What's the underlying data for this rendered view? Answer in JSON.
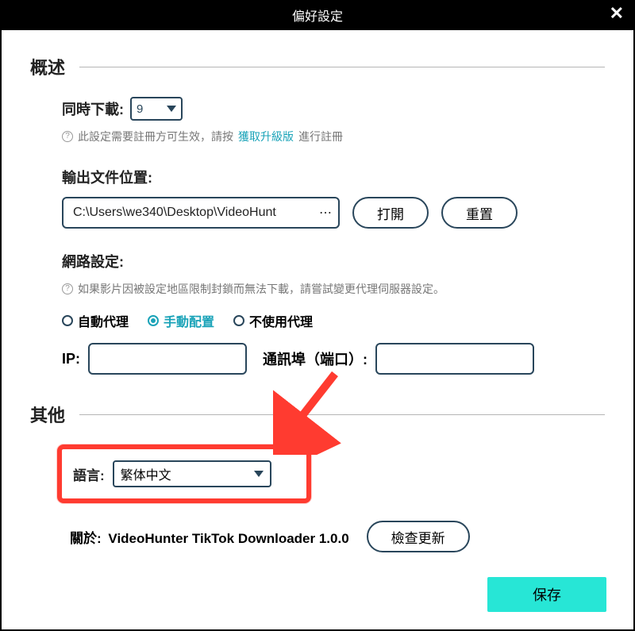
{
  "window": {
    "title": "偏好設定"
  },
  "overview": {
    "heading": "概述",
    "concurrent_label": "同時下載:",
    "concurrent_value": "9",
    "concurrent_hint_prefix": "此設定需要註冊方可生效，請按",
    "concurrent_hint_link": "獲取升級版",
    "concurrent_hint_suffix": "進行註冊",
    "output_label": "輸出文件位置:",
    "output_path": "C:\\Users\\we340\\Desktop\\VideoHunt",
    "open_btn": "打開",
    "reset_btn": "重置",
    "network_label": "網路設定:",
    "network_hint": "如果影片因被設定地區限制封鎖而無法下載，請嘗試變更代理伺服器設定。",
    "proxy_auto": "自動代理",
    "proxy_manual": "手動配置",
    "proxy_none": "不使用代理",
    "ip_label": "IP:",
    "port_label": "通訊埠（端口）:"
  },
  "other": {
    "heading": "其他",
    "lang_label": "語言:",
    "lang_value": "繁体中文",
    "about_label": "關於:",
    "about_value": "VideoHunter TikTok Downloader 1.0.0",
    "check_update": "檢查更新"
  },
  "actions": {
    "save": "保存"
  }
}
